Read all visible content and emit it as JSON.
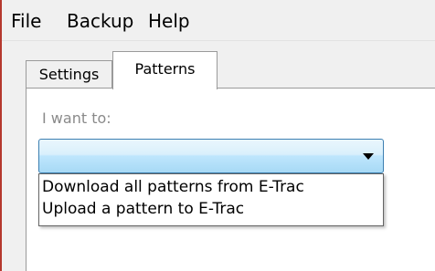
{
  "menu": {
    "file": "File",
    "backup": "Backup",
    "help": "Help"
  },
  "tabs": [
    {
      "label": "Settings",
      "selected": false
    },
    {
      "label": "Patterns",
      "selected": true
    }
  ],
  "patterns": {
    "label": "I want to:",
    "select": {
      "value": "",
      "expanded": true,
      "options": [
        "Download all patterns from E-Trac",
        "Upload a pattern to E-Trac"
      ]
    }
  },
  "colors": {
    "window_border": "#b5382e",
    "combo_border": "#3c7fb1",
    "combo_fill": "#bee6fd",
    "label_gray": "#8a8a8a"
  },
  "icons": {
    "dropdown": "chevron-down-icon"
  }
}
